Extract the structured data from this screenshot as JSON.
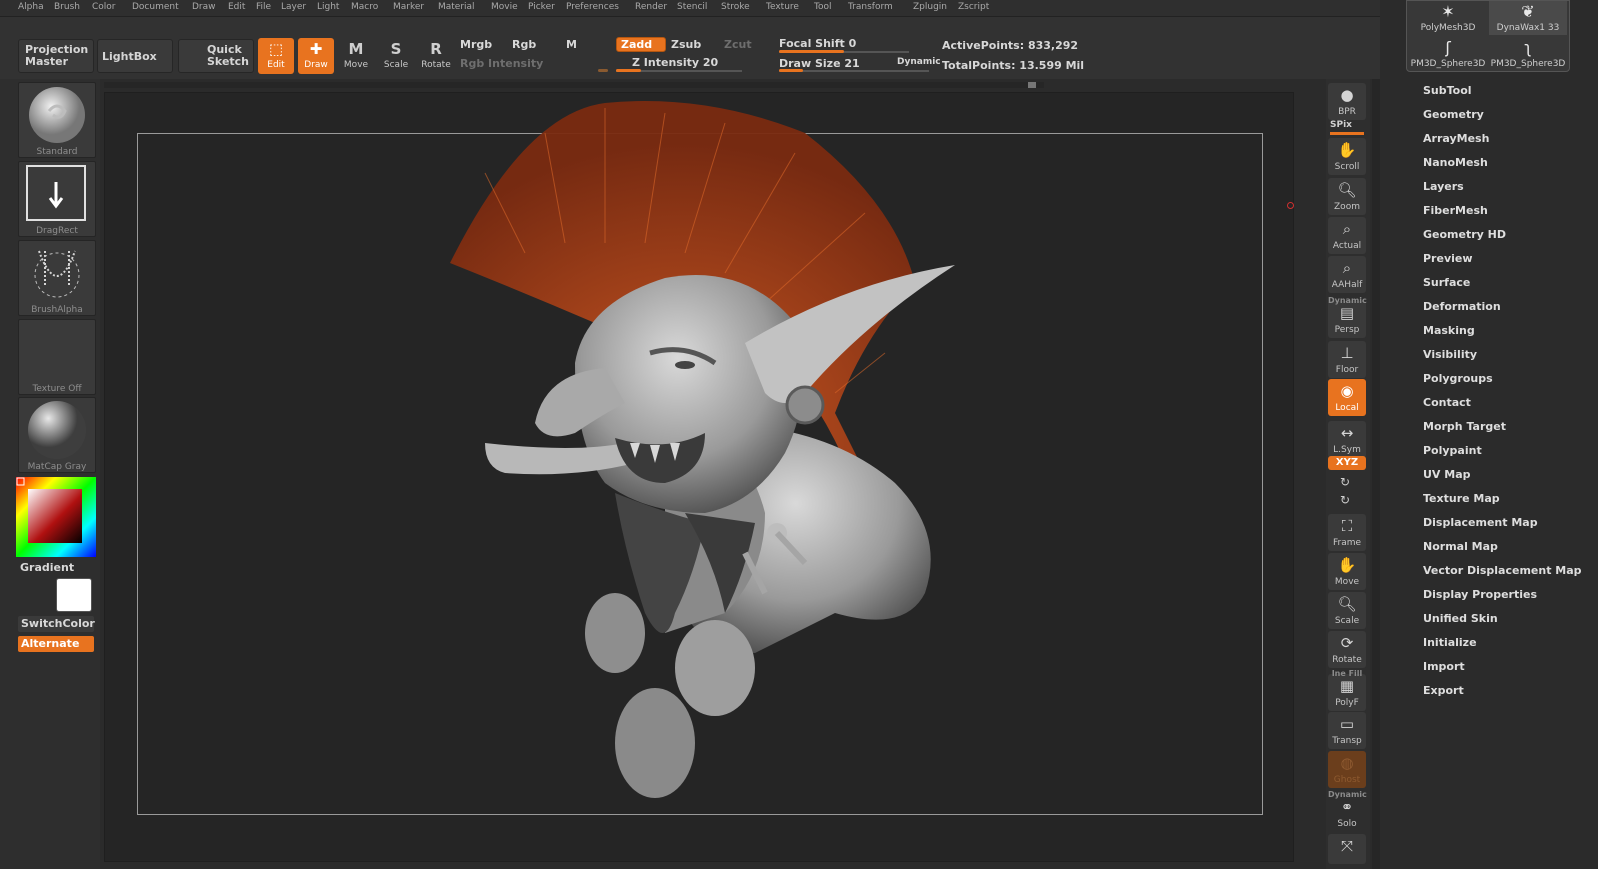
{
  "menu": [
    "Alpha",
    "Brush",
    "Color",
    "Document",
    "Draw",
    "Edit",
    "File",
    "Layer",
    "Light",
    "Macro",
    "Marker",
    "Material",
    "Movie",
    "Picker",
    "Preferences",
    "Render",
    "Stencil",
    "Stroke",
    "Texture",
    "Tool",
    "Transform",
    "Zplugin",
    "Zscript"
  ],
  "toolbar": {
    "projection_master": "Projection Master",
    "lightbox": "LightBox",
    "quick_sketch": "Quick Sketch",
    "edit": "Edit",
    "draw": "Draw",
    "move": "Move",
    "scale": "Scale",
    "rotate": "Rotate",
    "mrgb": "Mrgb",
    "rgb": "Rgb",
    "m": "M",
    "rgb_intensity": "Rgb Intensity",
    "zadd": "Zadd",
    "zsub": "Zsub",
    "zcut": "Zcut",
    "z_intensity": "Z Intensity 20",
    "focal_shift": "Focal Shift 0",
    "draw_size": "Draw Size 21",
    "dynamic": "Dynamic",
    "active_points": "ActivePoints: 833,292",
    "total_points": "TotalPoints: 13.599 Mil",
    "z_intensity_value": 0.2,
    "focal_shift_value": 0.5,
    "draw_size_value": 0.16
  },
  "left_shelf": {
    "brush": "Standard",
    "stroke": "DragRect",
    "alpha": "BrushAlpha",
    "texture": "Texture Off",
    "material": "MatCap Gray",
    "gradient": "Gradient",
    "switch_color": "SwitchColor",
    "alternate": "Alternate"
  },
  "right_shelf": {
    "bpr": "BPR",
    "spix": "SPix",
    "scroll": "Scroll",
    "zoom": "Zoom",
    "actual": "Actual",
    "aahalf": "AAHalf",
    "persp_dynamic": "Dynamic",
    "persp": "Persp",
    "floor": "Floor",
    "local": "Local",
    "lsym": "L.Sym",
    "xyz": "XYZ",
    "frame": "Frame",
    "move": "Move",
    "scale": "Scale",
    "rotate": "Rotate",
    "polyf_top": "Ine Fill",
    "polyf": "PolyF",
    "transp": "Transp",
    "ghost": "Ghost",
    "solo_dynamic": "Dynamic",
    "solo": "Solo"
  },
  "tools": [
    "PolyMesh3D",
    "DynaWax1 33",
    "PM3D_Sphere3D",
    "PM3D_Sphere3D"
  ],
  "palette": [
    "SubTool",
    "Geometry",
    "ArrayMesh",
    "NanoMesh",
    "Layers",
    "FiberMesh",
    "Geometry HD",
    "Preview",
    "Surface",
    "Deformation",
    "Masking",
    "Visibility",
    "Polygroups",
    "Contact",
    "Morph Target",
    "Polypaint",
    "UV Map",
    "Texture Map",
    "Displacement Map",
    "Normal Map",
    "Vector Displacement Map",
    "Display Properties",
    "Unified Skin",
    "Initialize",
    "Import",
    "Export"
  ],
  "colors": {
    "accent": "#e8731f",
    "hair": "#b3431a",
    "skin": "#9a9a9a"
  }
}
